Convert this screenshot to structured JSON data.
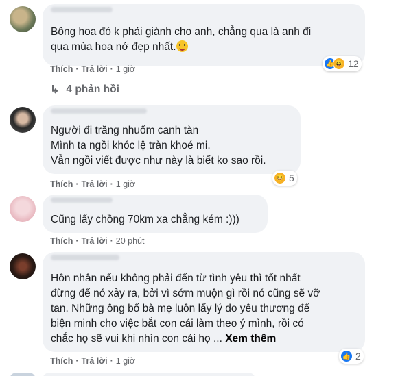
{
  "comments": [
    {
      "text": "Bông hoa đó k phải giành cho anh, chẳng qua là anh đi\nqua mùa hoa nở đẹp nhất.",
      "like": "Thích",
      "reply": "Trả lời",
      "time": "1 giờ",
      "reaction_count": "12",
      "reaction_icons": [
        "like-icon",
        "haha-icon"
      ],
      "replies_label": "4 phản hồi"
    },
    {
      "text": "Người đi trăng nhuốm canh tàn\nMình ta ngồi khóc lệ tràn khoé mi.\nVẫn ngồi viết được như này là biết ko sao rồi.",
      "like": "Thích",
      "reply": "Trả lời",
      "time": "1 giờ",
      "reaction_count": "5",
      "reaction_icons": [
        "haha-icon"
      ]
    },
    {
      "text": "Cũng lấy chồng 70km xa chẳng kém :)))",
      "like": "Thích",
      "reply": "Trả lời",
      "time": "20 phút"
    },
    {
      "text": "Hôn nhân nếu không phải đến từ tình yêu thì tốt nhất\nđừng để nó xảy ra, bởi vì sớm muộn gì rồi nó cũng sẽ vỡ\ntan. Những ông bố bà mẹ luôn lấy lý do yêu thương để\nbiện minh cho việc bắt con cái làm theo ý mình, rồi có\nchắc họ sẽ vui khi nhìn con cái họ ...",
      "see_more": "Xem thêm",
      "like": "Thích",
      "reply": "Trả lời",
      "time": "1 giờ",
      "reaction_count": "2",
      "reaction_icons": [
        "like-icon"
      ]
    }
  ],
  "colors": {
    "bubble": "#f0f2f5",
    "meta": "#65676b",
    "like_blue": "#1877f2",
    "haha_yellow": "#f7b125"
  }
}
